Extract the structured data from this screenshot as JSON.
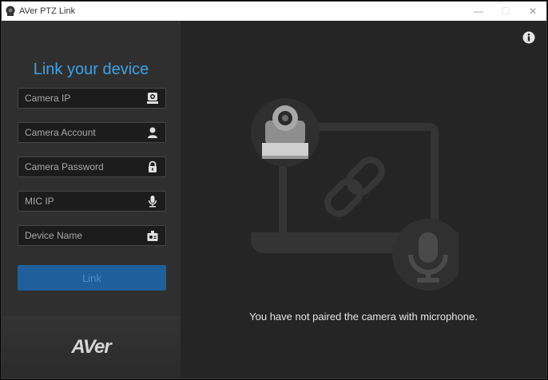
{
  "window": {
    "title": "AVer PTZ Link",
    "controls": {
      "minimize": "—",
      "maximize": "☐",
      "close": "✕"
    }
  },
  "sidebar": {
    "heading": "Link your device",
    "fields": [
      {
        "placeholder": "Camera IP",
        "icon": "camera-icon"
      },
      {
        "placeholder": "Camera Account",
        "icon": "user-icon"
      },
      {
        "placeholder": "Camera Password",
        "icon": "lock-icon"
      },
      {
        "placeholder": "MIC IP",
        "icon": "microphone-icon"
      },
      {
        "placeholder": "Device Name",
        "icon": "device-icon"
      }
    ],
    "link_button": "Link",
    "logo": "AVer"
  },
  "main": {
    "message": "You have not paired the camera with microphone.",
    "info_icon": "info-icon"
  },
  "colors": {
    "accent": "#3ea2e6",
    "button": "#1f5f9b",
    "sidebar_bg": "#2f2f2f",
    "main_bg": "#252525"
  }
}
